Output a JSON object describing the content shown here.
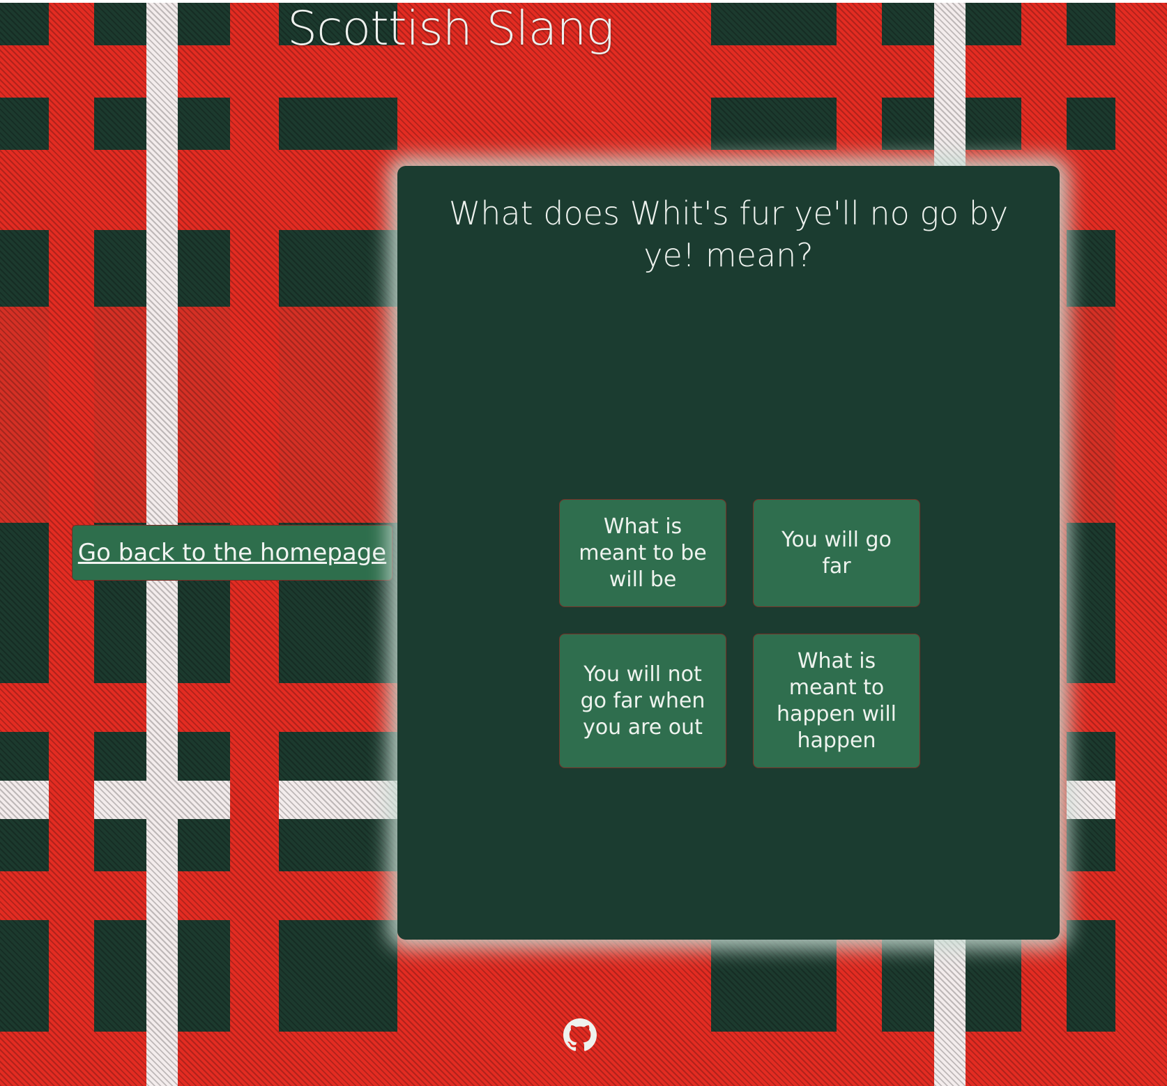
{
  "header": {
    "title": "Scottish Slang"
  },
  "nav": {
    "home_link_label": "Go back to the homepage"
  },
  "quiz": {
    "question": "What does Whit's fur ye'll no go by ye! mean?",
    "answers": [
      "What is meant to be will be",
      "You will go far",
      "You will not go far when you are out",
      "What is meant to happen will happen"
    ]
  },
  "footer": {
    "icon": "github-icon"
  },
  "colors": {
    "panel": "#1b3c30",
    "button": "#2f6e4e",
    "tartan_red": "#e32c22",
    "tartan_green": "#1c3a2e"
  }
}
